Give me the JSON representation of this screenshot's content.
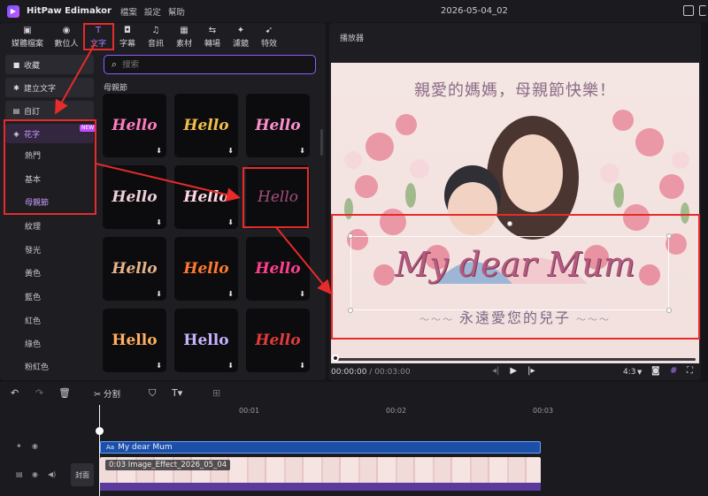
{
  "app": {
    "title": "HitPaw Edimakor",
    "project_name": "2026-05-04_02",
    "menu": [
      "檔案",
      "設定",
      "幫助"
    ]
  },
  "toolbar": {
    "tabs": [
      {
        "label": "媒體檔案",
        "icon": "media-icon"
      },
      {
        "label": "數位人",
        "icon": "avatar-icon"
      },
      {
        "label": "文字",
        "icon": "text-icon",
        "active": true
      },
      {
        "label": "字幕",
        "icon": "subtitle-icon"
      },
      {
        "label": "音訊",
        "icon": "audio-icon"
      },
      {
        "label": "素材",
        "icon": "assets-icon"
      },
      {
        "label": "轉場",
        "icon": "transition-icon"
      },
      {
        "label": "濾鏡",
        "icon": "filter-icon"
      },
      {
        "label": "特效",
        "icon": "effects-icon"
      }
    ]
  },
  "sidebar": {
    "categories": [
      {
        "label": "收藏",
        "icon": "star-icon"
      },
      {
        "label": "建立文字",
        "icon": "create-text-icon"
      },
      {
        "label": "自訂",
        "icon": "custom-icon"
      },
      {
        "label": "花字",
        "icon": "fancy-text-icon",
        "active": true,
        "badge": "NEW"
      }
    ],
    "subcategories": [
      {
        "label": "熱門"
      },
      {
        "label": "基本"
      },
      {
        "label": "母親節",
        "active": true
      }
    ],
    "more": [
      "紋理",
      "發光",
      "黃色",
      "藍色",
      "紅色",
      "綠色",
      "粉紅色"
    ]
  },
  "search": {
    "placeholder": "搜索"
  },
  "section_title": "母親節",
  "thumbnails": [
    {
      "label": "Hello",
      "color": "#ff7bc0"
    },
    {
      "label": "Hello",
      "color": "#f2c04a"
    },
    {
      "label": "Hello",
      "color": "#ff8fcf"
    },
    {
      "label": "Hello",
      "color": "#f0d0d8"
    },
    {
      "label": "Hello",
      "color": "#ffd9e4"
    },
    {
      "label": "Hello",
      "color": "#a34f7f"
    },
    {
      "label": "Hello",
      "color": "#e6b48a"
    },
    {
      "label": "Hello",
      "color": "#ff7a2e"
    },
    {
      "label": "Hello",
      "color": "#ff3f8f"
    },
    {
      "label": "Hello",
      "color": "#ffb060"
    },
    {
      "label": "Hello",
      "color": "#c9b3ff"
    },
    {
      "label": "Hello",
      "color": "#e23b3b"
    }
  ],
  "player": {
    "title": "播放器",
    "canvas_heading": "親愛的媽媽，母親節快樂！",
    "main_text": "My dear Mum",
    "subtitle": "永遠愛您的兒子",
    "time_current": "00:00:00",
    "time_total": "/ 00:03:00",
    "ratio": "4:3",
    "progress": 0
  },
  "timeline": {
    "split_label": "分割",
    "ticks": [
      "00:01",
      "00:02",
      "00:03"
    ],
    "text_clip": "My dear Mum",
    "image_clip": "0:03  Image_Effect_2026_05_04",
    "cover_label": "封面"
  }
}
